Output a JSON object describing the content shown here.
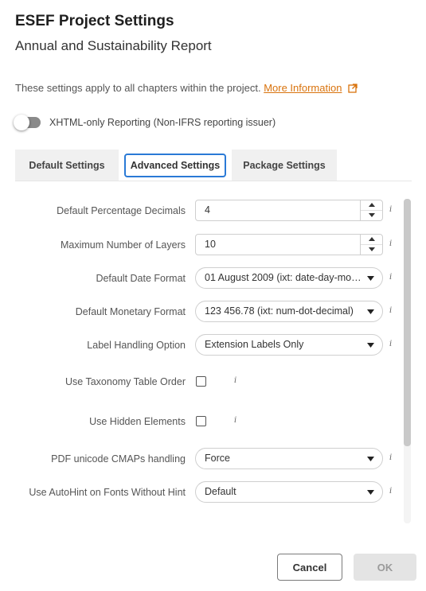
{
  "dialog": {
    "title": "ESEF Project Settings",
    "subtitle": "Annual and Sustainability Report"
  },
  "info": {
    "text": "These settings apply to all chapters within the project.",
    "link": "More Information"
  },
  "toggle": {
    "label": "XHTML-only Reporting (Non-IFRS reporting issuer)",
    "on": false
  },
  "tabs": [
    {
      "label": "Default Settings"
    },
    {
      "label": "Advanced Settings",
      "active": true
    },
    {
      "label": "Package Settings"
    }
  ],
  "fields": {
    "pct_decimals": {
      "label": "Default Percentage Decimals",
      "value": "4"
    },
    "max_layers": {
      "label": "Maximum Number of Layers",
      "value": "10"
    },
    "date_format": {
      "label": "Default Date Format",
      "value": "01 August 2009 (ixt: date-day-mon…"
    },
    "monetary_format": {
      "label": "Default Monetary Format",
      "value": "123 456.78 (ixt: num-dot-decimal)"
    },
    "label_handling": {
      "label": "Label Handling Option",
      "value": "Extension Labels Only"
    },
    "taxonomy_order": {
      "label": "Use Taxonomy Table Order",
      "checked": false
    },
    "hidden_elements": {
      "label": "Use Hidden Elements",
      "checked": false
    },
    "pdf_cmaps": {
      "label": "PDF unicode CMAPs handling",
      "value": "Force"
    },
    "autohint": {
      "label": "Use AutoHint on Fonts Without Hint",
      "value": "Default"
    }
  },
  "info_glyph": "i",
  "buttons": {
    "cancel": "Cancel",
    "ok": "OK"
  },
  "colors": {
    "link": "#d9730d",
    "active_tab_border": "#2a7ad6",
    "ok_disabled_bg": "#e4e4e4"
  }
}
